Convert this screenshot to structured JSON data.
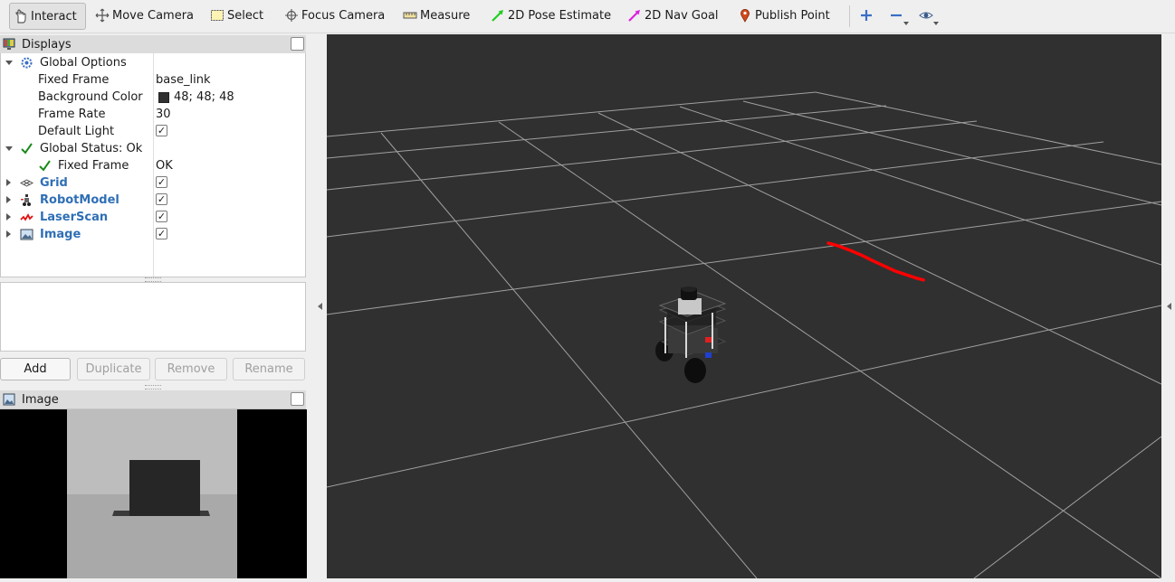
{
  "toolbar": {
    "tools": [
      {
        "label": "Interact",
        "icon": "hand-cursor-icon"
      },
      {
        "label": "Move Camera",
        "icon": "move-arrows-icon"
      },
      {
        "label": "Select",
        "icon": "select-box-icon"
      },
      {
        "label": "Focus Camera",
        "icon": "crosshair-icon"
      },
      {
        "label": "Measure",
        "icon": "ruler-icon"
      },
      {
        "label": "2D Pose Estimate",
        "icon": "green-arrow-icon"
      },
      {
        "label": "2D Nav Goal",
        "icon": "magenta-arrow-icon"
      },
      {
        "label": "Publish Point",
        "icon": "map-pin-icon"
      }
    ],
    "extra_icons": [
      "plus-icon",
      "minus-icon",
      "eye-icon"
    ]
  },
  "displays_panel": {
    "title": "Displays",
    "global_options": {
      "label": "Global Options",
      "fixed_frame_label": "Fixed Frame",
      "fixed_frame_value": "base_link",
      "background_color_label": "Background Color",
      "background_color_value": "48; 48; 48",
      "background_color_hex": "#303030",
      "frame_rate_label": "Frame Rate",
      "frame_rate_value": "30",
      "default_light_label": "Default Light",
      "default_light_checked": true
    },
    "global_status": {
      "label": "Global Status: Ok",
      "fixed_frame_label": "Fixed Frame",
      "fixed_frame_value": "OK"
    },
    "displays": [
      {
        "label": "Grid",
        "icon": "grid-icon",
        "checked": true
      },
      {
        "label": "RobotModel",
        "icon": "robot-icon",
        "checked": true
      },
      {
        "label": "LaserScan",
        "icon": "laser-scan-icon",
        "checked": true
      },
      {
        "label": "Image",
        "icon": "image-icon",
        "checked": true
      }
    ],
    "check_mark": "✓",
    "buttons": {
      "add": "Add",
      "duplicate": "Duplicate",
      "remove": "Remove",
      "rename": "Rename"
    }
  },
  "image_panel": {
    "title": "Image"
  },
  "colors": {
    "link_blue": "#2f6fb5",
    "status_green": "#1a8a1a",
    "laser_red": "#ff0000",
    "viewport_bg": "#303030"
  }
}
